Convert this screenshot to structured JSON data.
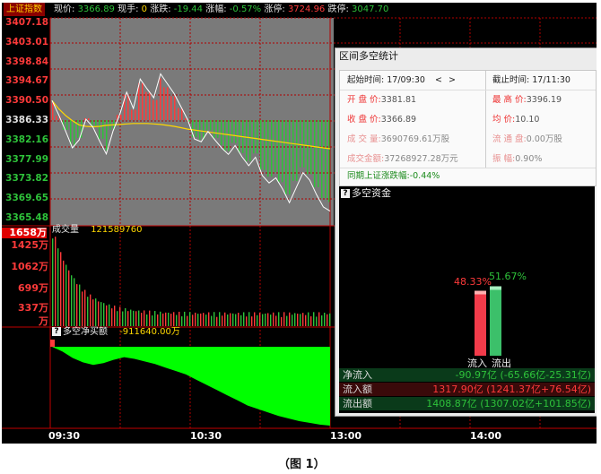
{
  "top_bar": {
    "index_name": "上证指数",
    "price_label": "现价:",
    "price_value": "3366.89",
    "hand_label": "现手:",
    "hand_value": "0",
    "change_label": "涨跌:",
    "change_value": "-19.44",
    "pct_label": "涨幅:",
    "pct_value": "-0.57%",
    "limit_up_label": "涨停:",
    "limit_up_value": "3724.96",
    "limit_down_label": "跌停:",
    "limit_down_value": "3047.70"
  },
  "price_axis": [
    "3407.18",
    "3403.01",
    "3398.84",
    "3394.67",
    "3390.50",
    "3386.33",
    "3382.16",
    "3377.99",
    "3373.82",
    "3369.65",
    "3365.48"
  ],
  "volume_panel": {
    "title": "成交量",
    "value": "121589760",
    "axis": [
      "1658万",
      "1425万",
      "1062万",
      "699万",
      "337万",
      "万"
    ]
  },
  "net_buy_panel": {
    "title": "多空净买额",
    "value": "-911640.00万"
  },
  "time_axis": [
    "09:30",
    "10:30",
    "13:00",
    "14:00"
  ],
  "dialog": {
    "title": "区间多空统计",
    "start_label": "起始时间:",
    "start_value": "17/09:30",
    "nav_prev": "<",
    "nav_next": ">",
    "end_label": "截止时间:",
    "end_value": "17/11:30",
    "open_label": "开 盘 价:",
    "open_value": "3381.81",
    "high_label": "最 高 价:",
    "high_value": "3396.19",
    "close_label": "收 盘 价:",
    "close_value": "3366.89",
    "avg_label": "均    价:",
    "avg_value": "10.10",
    "vol_label": "成 交 量:",
    "vol_value": "3690769.61万股",
    "float_label": "流 通 盘:",
    "float_value": "0.00万股",
    "amount_label": "成交金额:",
    "amount_value": "37268927.28万元",
    "amp_label": "振    幅:",
    "amp_value": "0.90%",
    "same_period_label": "同期上证涨跌幅:",
    "same_period_value": "-0.44%"
  },
  "fund": {
    "title": "多空资金",
    "inflow_pct": "48.33%",
    "outflow_pct": "51.67%",
    "inflow_ratio": 0.4833,
    "outflow_ratio": 0.5167,
    "inflow_label": "流入",
    "outflow_label": "流出",
    "rows": [
      {
        "label": "净流入",
        "value": "-90.97亿 (-65.66亿-25.31亿)"
      },
      {
        "label": "流入额",
        "value": "1317.90亿 (1241.37亿+76.54亿)"
      },
      {
        "label": "流出额",
        "value": "1408.87亿 (1307.02亿+101.85亿)"
      }
    ]
  },
  "colors": {
    "up": "#ff3a3a",
    "down": "#2ec23a",
    "net_fill": "#00ff00",
    "price_line": "#ffffff",
    "avg_line": "#ffd700"
  },
  "caption": "（图 1）"
}
